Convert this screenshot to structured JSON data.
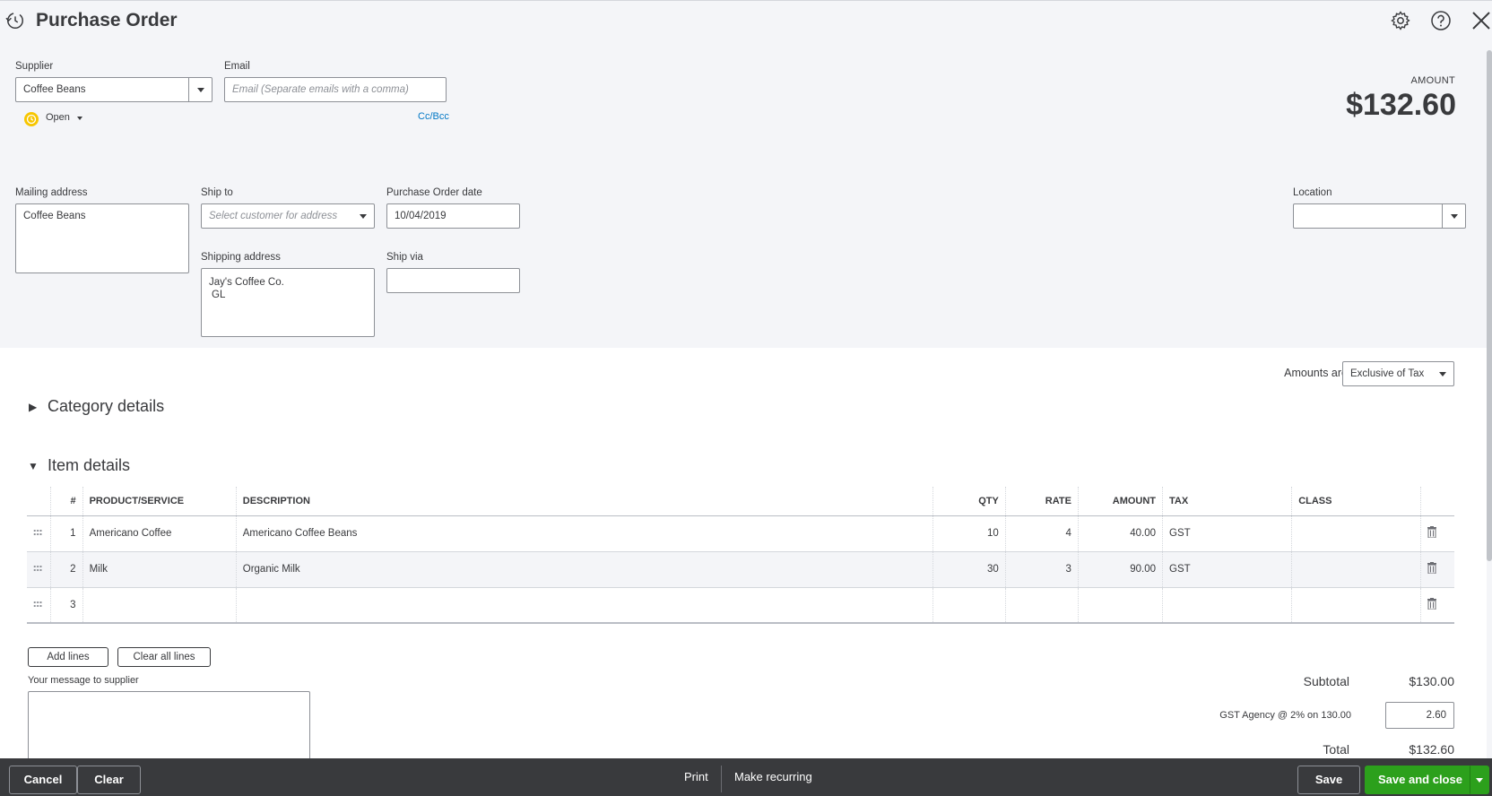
{
  "header": {
    "title": "Purchase Order",
    "icons": [
      "recent-transactions-icon",
      "gear-icon",
      "help-icon",
      "close-icon"
    ]
  },
  "supplier": {
    "label": "Supplier",
    "value": "Coffee Beans"
  },
  "email": {
    "label": "Email",
    "placeholder": "Email (Separate emails with a comma)",
    "cc_bcc": "Cc/Bcc"
  },
  "status": {
    "label": "Open"
  },
  "amount": {
    "label": "AMOUNT",
    "value": "$132.60"
  },
  "mailing_address": {
    "label": "Mailing address",
    "value": "Coffee Beans"
  },
  "ship_to": {
    "label": "Ship to",
    "placeholder": "Select customer for address"
  },
  "shipping_address": {
    "label": "Shipping address",
    "line1": "Jay's Coffee Co.",
    "line2": "GL"
  },
  "po_date": {
    "label": "Purchase Order date",
    "value": "10/04/2019"
  },
  "ship_via": {
    "label": "Ship via",
    "value": ""
  },
  "location": {
    "label": "Location",
    "value": ""
  },
  "amounts_are": {
    "label": "Amounts are",
    "value": "Exclusive of Tax"
  },
  "category_details": {
    "title": "Category details",
    "expanded": false
  },
  "item_details": {
    "title": "Item details",
    "expanded": true,
    "columns": [
      "#",
      "PRODUCT/SERVICE",
      "DESCRIPTION",
      "QTY",
      "RATE",
      "AMOUNT",
      "TAX",
      "CLASS"
    ],
    "rows": [
      {
        "num": "1",
        "product": "Americano Coffee",
        "description": "Americano Coffee Beans",
        "qty": "10",
        "rate": "4",
        "amount": "40.00",
        "tax": "GST",
        "class": ""
      },
      {
        "num": "2",
        "product": "Milk",
        "description": "Organic Milk",
        "qty": "30",
        "rate": "3",
        "amount": "90.00",
        "tax": "GST",
        "class": ""
      },
      {
        "num": "3",
        "product": "",
        "description": "",
        "qty": "",
        "rate": "",
        "amount": "",
        "tax": "",
        "class": ""
      }
    ]
  },
  "line_buttons": {
    "add": "Add lines",
    "clear": "Clear all lines"
  },
  "message": {
    "label": "Your message to supplier",
    "value": ""
  },
  "totals": {
    "subtotal_label": "Subtotal",
    "subtotal_value": "$130.00",
    "tax_label": "GST Agency @ 2% on 130.00",
    "tax_value": "2.60",
    "total_label": "Total",
    "total_value": "$132.60"
  },
  "footer": {
    "cancel": "Cancel",
    "clear": "Clear",
    "print": "Print",
    "make_recurring": "Make recurring",
    "save": "Save",
    "save_and_close": "Save and close"
  },
  "colors": {
    "brand_green": "#2ca01c",
    "link_blue": "#0077c5",
    "footer_bg": "#393a3d",
    "panel_bg": "#f4f5f8",
    "status_yellow": "#f7c600"
  }
}
